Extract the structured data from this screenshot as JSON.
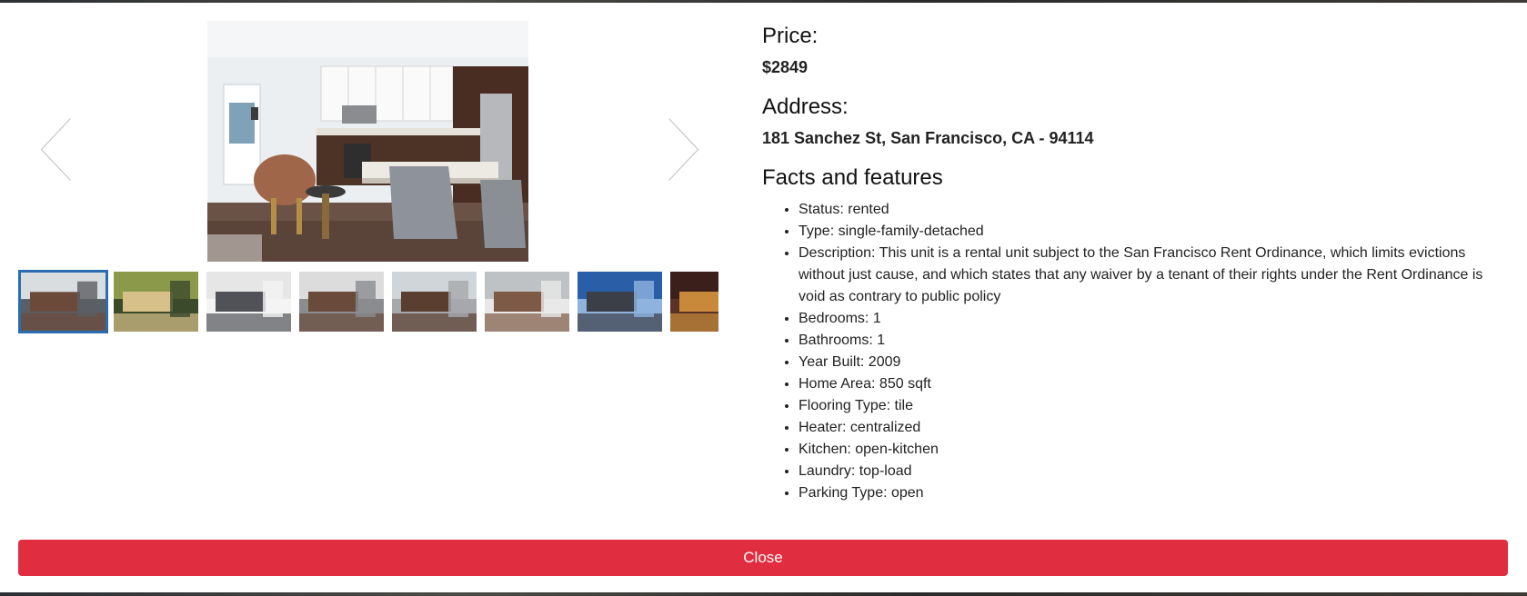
{
  "price": {
    "label": "Price:",
    "value": "$2849"
  },
  "address": {
    "label": "Address:",
    "value": "181 Sanchez St, San Francisco, CA - 94114"
  },
  "facts": {
    "title": "Facts and features",
    "items": [
      "Status: rented",
      "Type: single-family-detached",
      "Description: This unit is a rental unit subject to the San Francisco Rent Ordinance, which limits evictions without just cause, and which states that any waiver by a tenant of their rights under the Rent Ordinance is void as contrary to public policy",
      "Bedrooms: 1",
      "Bathrooms: 1",
      "Year Built: 2009",
      "Home Area: 850 sqft",
      "Flooring Type: tile",
      "Heater: centralized",
      "Kitchen: open-kitchen",
      "Laundry: top-load",
      "Parking Type: open"
    ]
  },
  "gallery": {
    "prev_icon": "chevron-left-icon",
    "next_icon": "chevron-right-icon",
    "active_index": 0,
    "thumbnails": [
      {
        "name": "thumbnail-kitchen-dining",
        "palette": [
          "#d9dde0",
          "#6b4a3a",
          "#5b5e64"
        ]
      },
      {
        "name": "thumbnail-courtyard",
        "palette": [
          "#8a9a4a",
          "#d8c08a",
          "#3b4a2a"
        ]
      },
      {
        "name": "thumbnail-bedroom",
        "palette": [
          "#e6e6e6",
          "#505258",
          "#f4f4f4"
        ]
      },
      {
        "name": "thumbnail-kitchen-island",
        "palette": [
          "#dcdcdc",
          "#6a4a3a",
          "#8a8c90"
        ]
      },
      {
        "name": "thumbnail-kitchen-window",
        "palette": [
          "#cfd5d8",
          "#5a3e30",
          "#a6a8ac"
        ]
      },
      {
        "name": "thumbnail-laundry",
        "palette": [
          "#bfc2c4",
          "#7d5a45",
          "#e8e8e8"
        ]
      },
      {
        "name": "thumbnail-building-exterior",
        "palette": [
          "#2a5fa8",
          "#3a3f48",
          "#8fb3de"
        ]
      },
      {
        "name": "thumbnail-night-street",
        "palette": [
          "#3b1f1a",
          "#c88a3a",
          "#5a3326"
        ]
      }
    ]
  },
  "close_label": "Close",
  "colors": {
    "close_button": "#e02d3f",
    "active_thumb_border": "#2b6cb0"
  }
}
